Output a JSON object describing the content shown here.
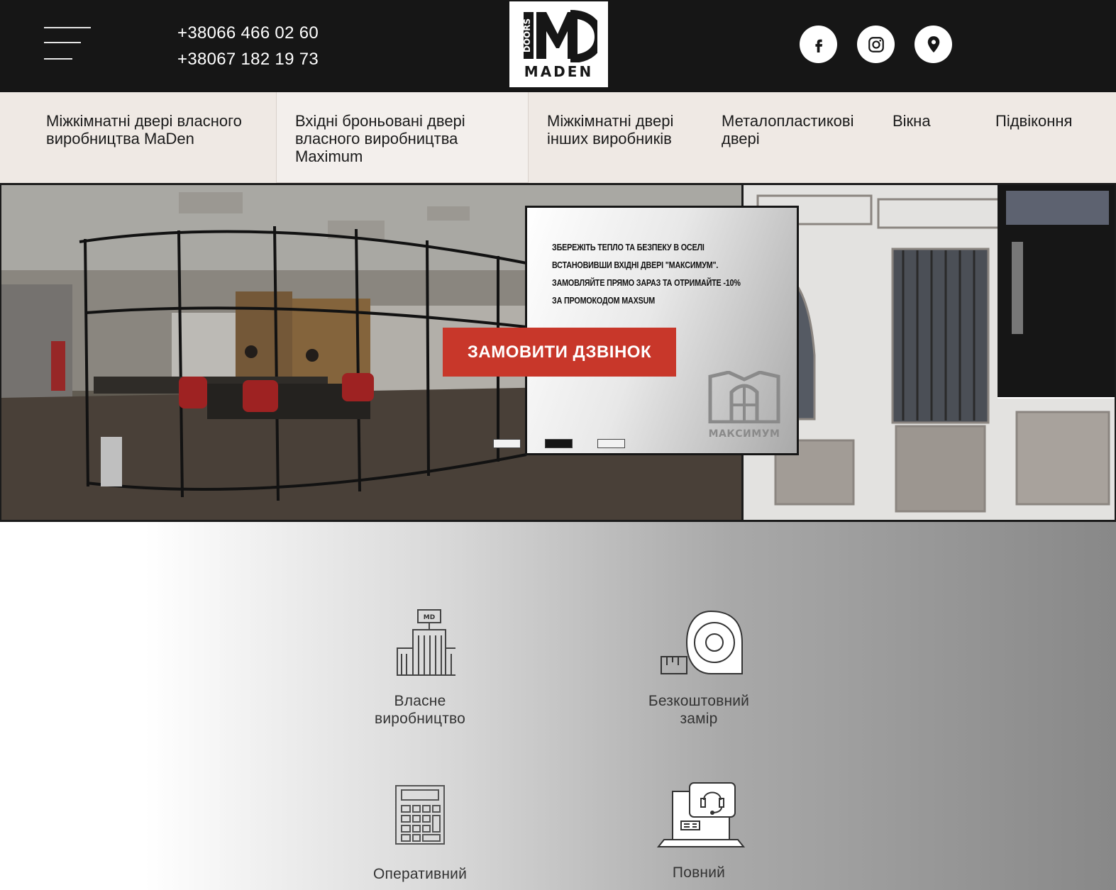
{
  "header": {
    "phones": [
      "+38066 466 02 60",
      "+38067 182 19 73"
    ],
    "logo": {
      "mark": "MD",
      "side_text": "DOORS",
      "brand": "MADEN"
    },
    "social": [
      {
        "name": "facebook",
        "icon": "facebook-icon"
      },
      {
        "name": "instagram",
        "icon": "instagram-icon"
      },
      {
        "name": "location",
        "icon": "map-pin-icon"
      }
    ]
  },
  "nav": {
    "items": [
      {
        "label": "Міжкімнатні двері власного виробництва MaDen"
      },
      {
        "label": "Вхідні броньовані двері власного виробництва Maximum",
        "active": true
      },
      {
        "label": "Міжкімнатні двері інших виробників"
      },
      {
        "label": "Металопластикові двері"
      },
      {
        "label": "Вікна"
      },
      {
        "label": "Підвіконня"
      }
    ]
  },
  "hero": {
    "promo_lines": [
      "ЗБЕРЕЖІТЬ ТЕПЛО ТА БЕЗПЕКУ В ОСЕЛІ",
      "ВСТАНОВИВШИ ВХІДНІ ДВЕРІ \"МАКСИМУМ\".",
      "ЗАМОВЛЯЙТЕ ПРЯМО ЗАРАЗ ТА ОТРИМАЙТЕ -10%",
      "ЗА ПРОМОКОДОМ MAXSUM"
    ],
    "promo_brand": "МАКСИМУМ",
    "cta_label": "ЗАМОВИТИ ДЗВІНОК",
    "slides": {
      "count": 3,
      "active_index": 1
    },
    "colors": {
      "cta": "#c8372a",
      "header": "#161616",
      "nav": "#efe9e4"
    }
  },
  "features": [
    {
      "label_lines": [
        "Власне",
        "виробництво"
      ],
      "icon": "factory-icon"
    },
    {
      "label_lines": [
        "Безкоштовний",
        "замір"
      ],
      "icon": "tape-measure-icon"
    },
    {
      "label_lines": [
        "Оперативний",
        ""
      ],
      "icon": "calculator-icon"
    },
    {
      "label_lines": [
        "Повний",
        ""
      ],
      "icon": "support-laptop-icon"
    }
  ]
}
